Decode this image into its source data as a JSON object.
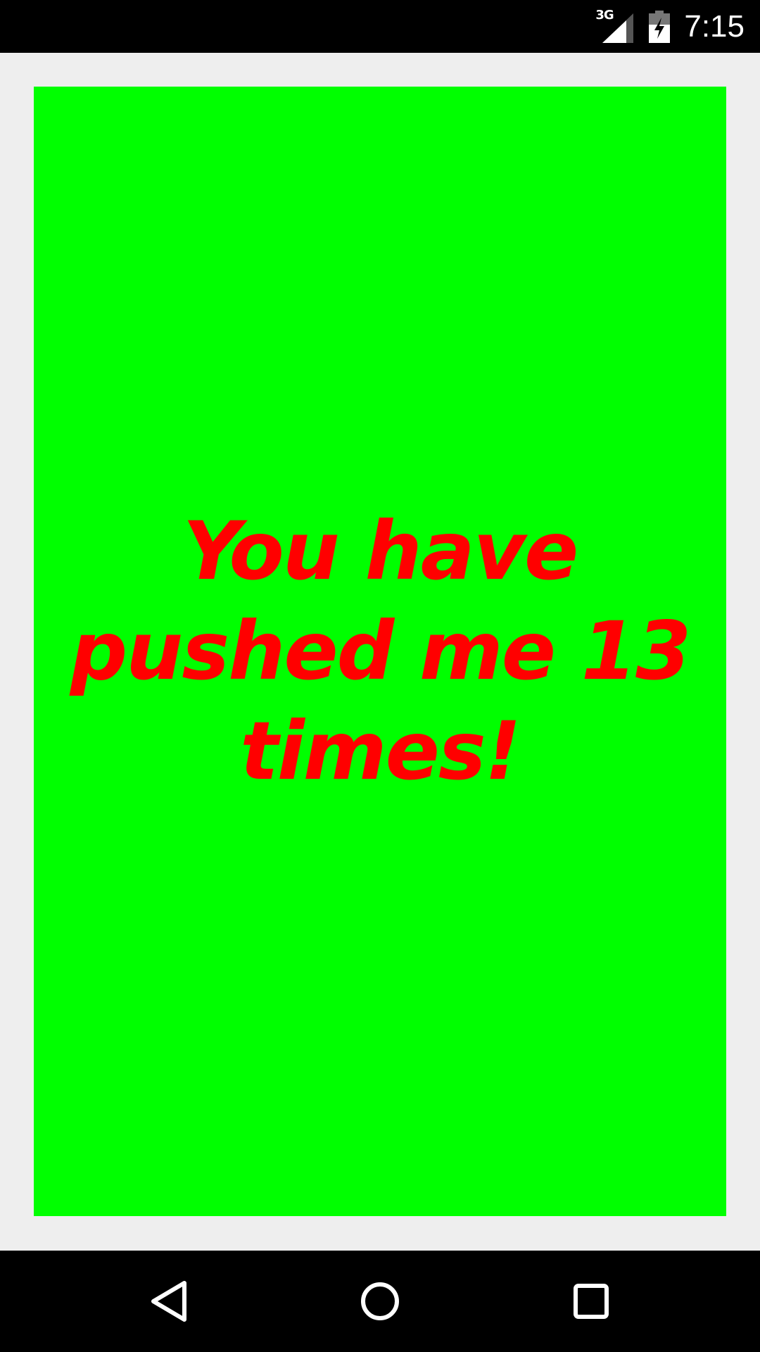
{
  "status_bar": {
    "network_type": "3G",
    "signal_icon": "cellular-signal-icon",
    "battery_icon": "battery-charging-icon",
    "time": "7:15"
  },
  "main": {
    "message": "You have pushed me 13 times!",
    "background_color": "#00ff00",
    "text_color": "#ff0000"
  },
  "nav_bar": {
    "back_icon": "back-icon",
    "home_icon": "home-icon",
    "recents_icon": "recents-icon"
  }
}
